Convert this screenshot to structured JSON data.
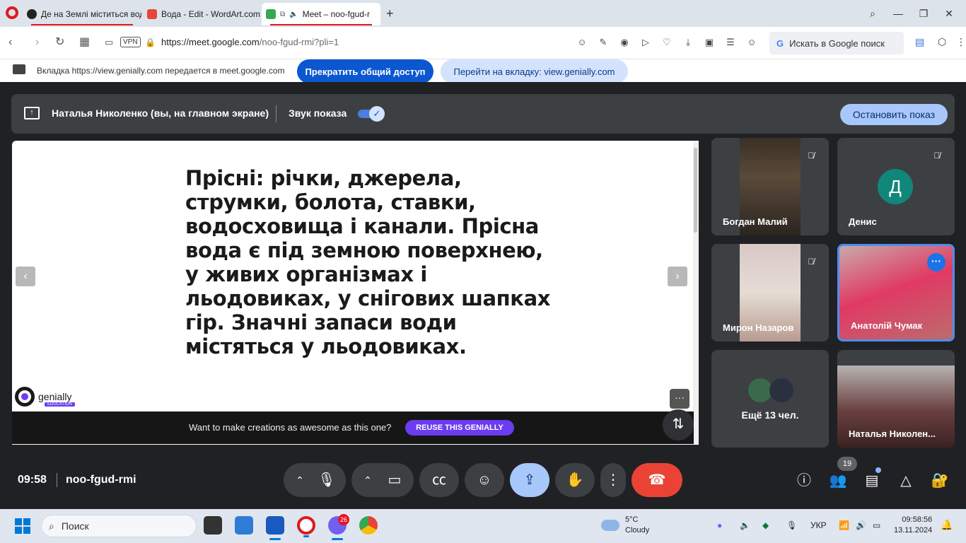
{
  "browser": {
    "tabs": [
      {
        "title": "Де на Землі міститься вод",
        "color": "#000000"
      },
      {
        "title": "Вода - Edit - WordArt.com",
        "color": "#e8453c"
      },
      {
        "title": "Meet – noo-fgud-r",
        "color": "#34a853"
      }
    ],
    "new_tab": "+",
    "url_main": "https://meet.google.com",
    "url_path": "/noo-fgud-rmi?pli=1",
    "vpn_label": "VPN",
    "search_box": "Искать в Google поиск",
    "search_g": "G"
  },
  "share_banner": {
    "message": "Вкладка https://view.genially.com передается в meet.google.com",
    "stop_sharing": "Прекратить общий доступ",
    "goto_tab": "Перейти на вкладку: view.genially.com"
  },
  "presentation_bar": {
    "presenter": "Наталья Николенко (вы, на главном экране)",
    "sound_label": "Звук показа",
    "toggle_check": "✓",
    "stop_button": "Остановить показ"
  },
  "slide": {
    "text": "Прісні: річки, джерела, струмки, болота, ставки, водосховища і канали. Прісна вода є під земною поверхнею, у живих організмах і льодовиках, у снігових шапках гір. Значні запаси води містяться у льодовиках.",
    "prev": "‹",
    "next": "›",
    "logo": "genially",
    "logo_sub": "EDUCATION",
    "more": "···",
    "footer_text": "Want to make creations as awesome as this one?",
    "reuse_button": "REUSE THIS GENIALLY",
    "swap": "⇅"
  },
  "participants": [
    {
      "name": "Богдан Малий",
      "muted": true
    },
    {
      "name": "Денис",
      "muted": true,
      "initial": "Д"
    },
    {
      "name": "Мирон Назаров",
      "muted": true
    },
    {
      "name": "Анатолій Чумак",
      "muted": false,
      "speaking": true
    },
    {
      "name": "Ещё 13 чел."
    },
    {
      "name": "Наталья Николен..."
    }
  ],
  "controls": {
    "time": "09:58",
    "meeting_code": "noo-fgud-rmi",
    "people_count": "19",
    "icons": [
      "chevron-up-icon",
      "mic-icon",
      "chevron-up-icon",
      "camera-icon",
      "captions-icon",
      "emoji-icon",
      "present-icon",
      "hand-icon",
      "more-vert-icon",
      "hangup-icon",
      "info-icon",
      "people-icon",
      "chat-icon",
      "activities-icon",
      "host-controls-icon"
    ]
  },
  "taskbar": {
    "search_placeholder": "Поиск",
    "viber_badge": "26",
    "weather_temp": "5°C",
    "weather_desc": "Cloudy",
    "lang": "УКР",
    "time": "09:58:56",
    "date": "13.11.2024"
  }
}
